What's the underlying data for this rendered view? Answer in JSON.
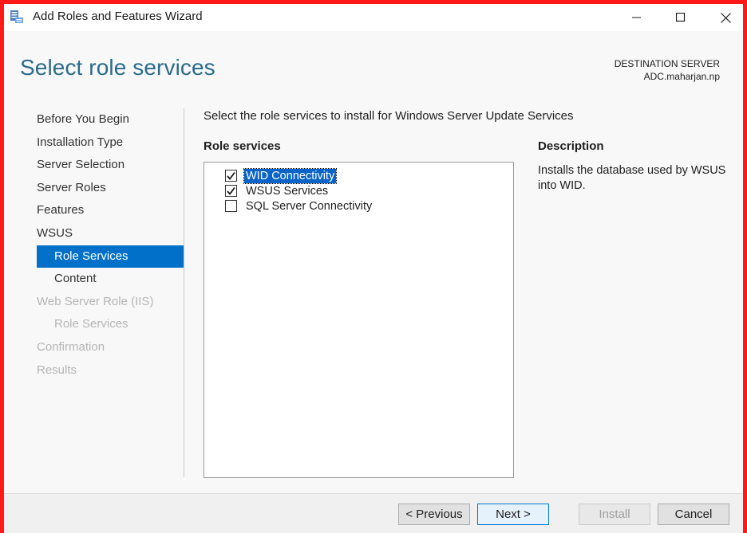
{
  "window": {
    "title": "Add Roles and Features Wizard",
    "icon": "server-manager-icon"
  },
  "header": {
    "page_title": "Select role services",
    "destination_label": "DESTINATION SERVER",
    "destination_server": "ADC.maharjan.np"
  },
  "nav": {
    "items": [
      {
        "label": "Before You Begin",
        "state": "normal"
      },
      {
        "label": "Installation Type",
        "state": "normal"
      },
      {
        "label": "Server Selection",
        "state": "normal"
      },
      {
        "label": "Server Roles",
        "state": "normal"
      },
      {
        "label": "Features",
        "state": "normal"
      },
      {
        "label": "WSUS",
        "state": "normal"
      },
      {
        "label": "Role Services",
        "state": "active",
        "sub": true
      },
      {
        "label": "Content",
        "state": "normal",
        "sub": true
      },
      {
        "label": "Web Server Role (IIS)",
        "state": "disabled"
      },
      {
        "label": "Role Services",
        "state": "disabled",
        "sub": true
      },
      {
        "label": "Confirmation",
        "state": "disabled"
      },
      {
        "label": "Results",
        "state": "disabled"
      }
    ]
  },
  "main": {
    "instruction": "Select the role services to install for Windows Server Update Services",
    "role_services_heading": "Role services",
    "role_services": [
      {
        "label": "WID Connectivity",
        "checked": true,
        "selected": true
      },
      {
        "label": "WSUS Services",
        "checked": true,
        "selected": false
      },
      {
        "label": "SQL Server Connectivity",
        "checked": false,
        "selected": false
      }
    ],
    "description_heading": "Description",
    "description_text": "Installs the database used by WSUS into WID."
  },
  "footer": {
    "previous_label": "< Previous",
    "next_label": "Next >",
    "install_label": "Install",
    "cancel_label": "Cancel"
  },
  "colors": {
    "title_accent": "#2a6c8e",
    "nav_active": "#0070c8",
    "frame_border": "#ff1a1a"
  }
}
